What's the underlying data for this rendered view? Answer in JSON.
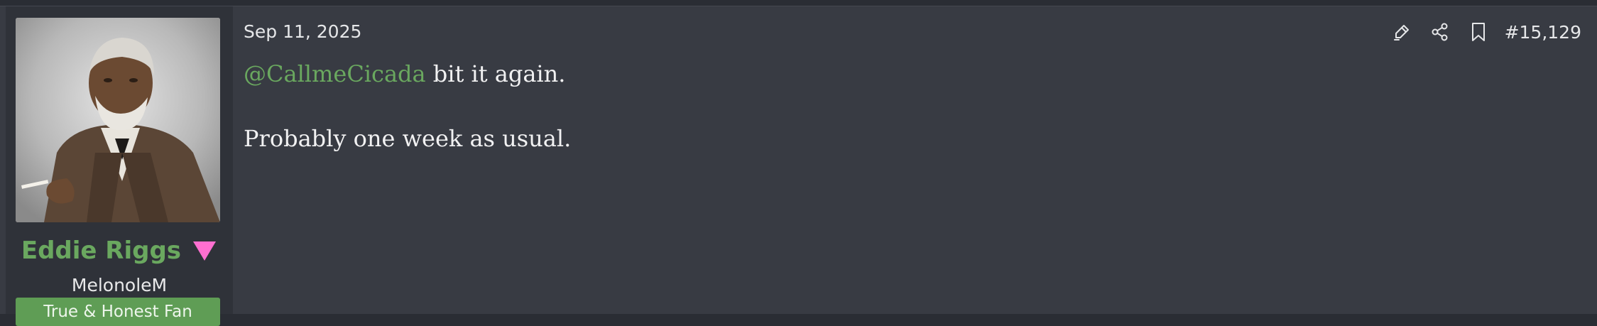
{
  "user": {
    "name": "Eddie Riggs",
    "title": "MelonoleM",
    "banner": "True & Honest Fan",
    "gender_icon": "pink-down-triangle-icon",
    "name_color": "#6aa85f"
  },
  "post": {
    "date": "Sep 11, 2025",
    "number": "#15,129",
    "mention": "@CallmeCicada",
    "line1_rest": " bit it again.",
    "line2": "Probably one week as usual."
  },
  "actions": {
    "icons": [
      "highlight-icon",
      "share-icon",
      "bookmark-icon"
    ]
  },
  "colors": {
    "background": "#383b43",
    "user_panel": "#2f3239",
    "accent_green": "#6aa85f",
    "banner_green": "#5f9d55",
    "triangle_pink": "#ff6fd0"
  }
}
